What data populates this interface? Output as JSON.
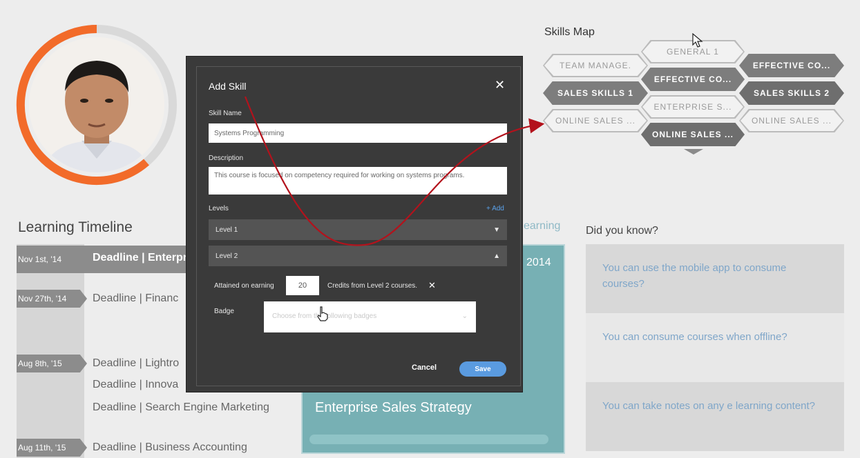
{
  "skills_map": {
    "title": "Skills Map",
    "hexes": [
      {
        "label": "GENERAL 1",
        "style": "light"
      },
      {
        "label": "TEAM MANAGE.",
        "style": "light"
      },
      {
        "label": "EFFECTIVE CO...",
        "style": "dark"
      },
      {
        "label": "EFFECTIVE CO...",
        "style": "dark"
      },
      {
        "label": "SALES SKILLS 1",
        "style": "dark"
      },
      {
        "label": "SALES SKILLS 2",
        "style": "darker"
      },
      {
        "label": "ENTERPRISE S...",
        "style": "light"
      },
      {
        "label": "ONLINE SALES ...",
        "style": "light"
      },
      {
        "label": "ONLINE SALES ...",
        "style": "light"
      },
      {
        "label": "ONLINE SALES ...",
        "style": "darker"
      }
    ]
  },
  "timeline": {
    "title": "Learning Timeline",
    "entries": [
      {
        "date": "Nov 1st, '14",
        "text": "Deadline | Enterpr"
      },
      {
        "date": "Nov 27th, '14",
        "text": "Deadline | Financ"
      },
      {
        "date": "Aug 8th, '15",
        "text": "Deadline | Lightro"
      },
      {
        "date": "",
        "text": "Deadline | Innova"
      },
      {
        "date": "",
        "text": "Deadline | Search Engine Marketing"
      },
      {
        "date": "Aug 11th, '15",
        "text": "Deadline | Business Accounting"
      }
    ]
  },
  "learning_link": "earning",
  "course": {
    "year": "2014",
    "title": "Enterprise Sales Strategy"
  },
  "did_you_know": {
    "title": "Did you know?",
    "tips": [
      "You can use the mobile app to consume courses?",
      "You can consume courses when offline?",
      "You can take notes on any e learning content?"
    ]
  },
  "modal": {
    "title": "Add Skill",
    "close": "✕",
    "skill_name_label": "Skill Name",
    "skill_name_value": "Systems Programming",
    "description_label": "Description",
    "description_value": "This course is focused on competency required for working on systems programs.",
    "levels_label": "Levels",
    "add_label": "+ Add",
    "levels": [
      {
        "label": "Level 1",
        "caret": "▼"
      },
      {
        "label": "Level 2",
        "caret": "▲"
      }
    ],
    "attained_label": "Attained on earning",
    "credits_value": "20",
    "credits_suffix": "Credits from Level 2 courses.",
    "remove": "✕",
    "badge_label": "Badge",
    "badge_placeholder": "Choose from the following badges",
    "badge_caret": "⌄",
    "cancel_label": "Cancel",
    "save_label": "Save"
  },
  "colors": {
    "accent_orange": "#f26b2a",
    "modal_bg": "#3a3a3a",
    "save_blue": "#5a9be0",
    "course_teal": "#77b0b4",
    "annotation_red": "#b3121c"
  }
}
